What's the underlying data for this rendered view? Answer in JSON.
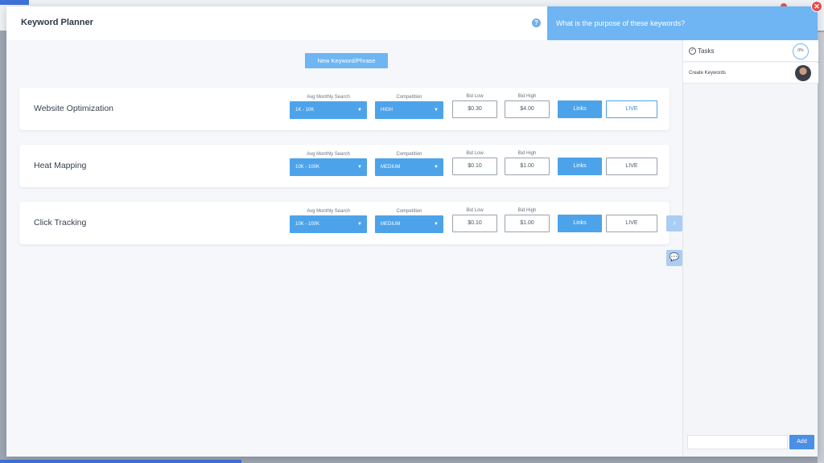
{
  "header": {
    "title": "Keyword Planner",
    "help_icon": "?",
    "prompt": "What is the purpose of these keywords?",
    "close_icon": "✕"
  },
  "toolbar": {
    "new_keyword_label": "New Keyword/Phrase"
  },
  "labels": {
    "avg_monthly_search": "Avg Monthly Search",
    "competition": "Competition",
    "bid_low": "Bid Low",
    "bid_high": "Bid High",
    "links": "Links",
    "live": "LIVE"
  },
  "keywords": [
    {
      "name": "Website Optimization",
      "avg_monthly_search": "1K - 10K",
      "competition": "HIGH",
      "bid_low": "$0.30",
      "bid_high": "$4.00"
    },
    {
      "name": "Heat Mapping",
      "avg_monthly_search": "10K - 100K",
      "competition": "MEDIUM",
      "bid_low": "$0.10",
      "bid_high": "$1.00"
    },
    {
      "name": "Click Tracking",
      "avg_monthly_search": "10K - 100K",
      "competition": "MEDIUM",
      "bid_low": "$0.10",
      "bid_high": "$1.00"
    }
  ],
  "side_tabs": {
    "expand_icon": "›",
    "chat_icon": "💬"
  },
  "tasks": {
    "title": "Tasks",
    "check_icon": "✓",
    "progress": "0%",
    "items": [
      {
        "label": "Create Keywords"
      }
    ],
    "add_placeholder": "",
    "add_label": "Add"
  },
  "colors": {
    "accent": "#4da3ea",
    "prompt_bg": "#6fb5f3",
    "close": "#e54b4b",
    "add_button": "#4b8fe6"
  }
}
